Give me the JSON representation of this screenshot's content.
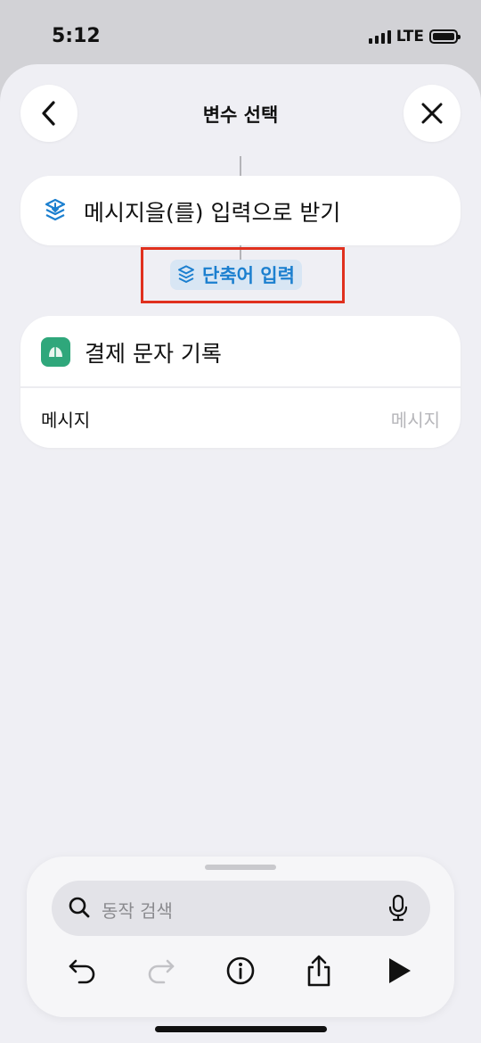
{
  "status_bar": {
    "time": "5:12",
    "network": "LTE"
  },
  "nav": {
    "title": "변수 선택",
    "back_icon": "chevron-left-icon",
    "close_icon": "close-icon"
  },
  "input_card": {
    "icon": "shortcut-input-icon",
    "label": "메시지을(를) 입력으로 받기"
  },
  "variable_token": {
    "icon": "shortcut-input-icon",
    "label": "단축어 입력",
    "highlight_color": "#e0301e"
  },
  "action_card": {
    "app_icon": "app-icon",
    "app_icon_color": "#2fa77b",
    "title": "결제 문자 기록",
    "param_label": "메시지",
    "param_placeholder": "메시지"
  },
  "bottom_panel": {
    "search_placeholder": "동작 검색",
    "toolbar": {
      "undo": "undo-icon",
      "redo": "redo-icon",
      "info": "info-icon",
      "share": "share-icon",
      "run": "play-icon"
    }
  },
  "colors": {
    "accent_blue": "#1b7fcf",
    "background": "#efeff4"
  }
}
